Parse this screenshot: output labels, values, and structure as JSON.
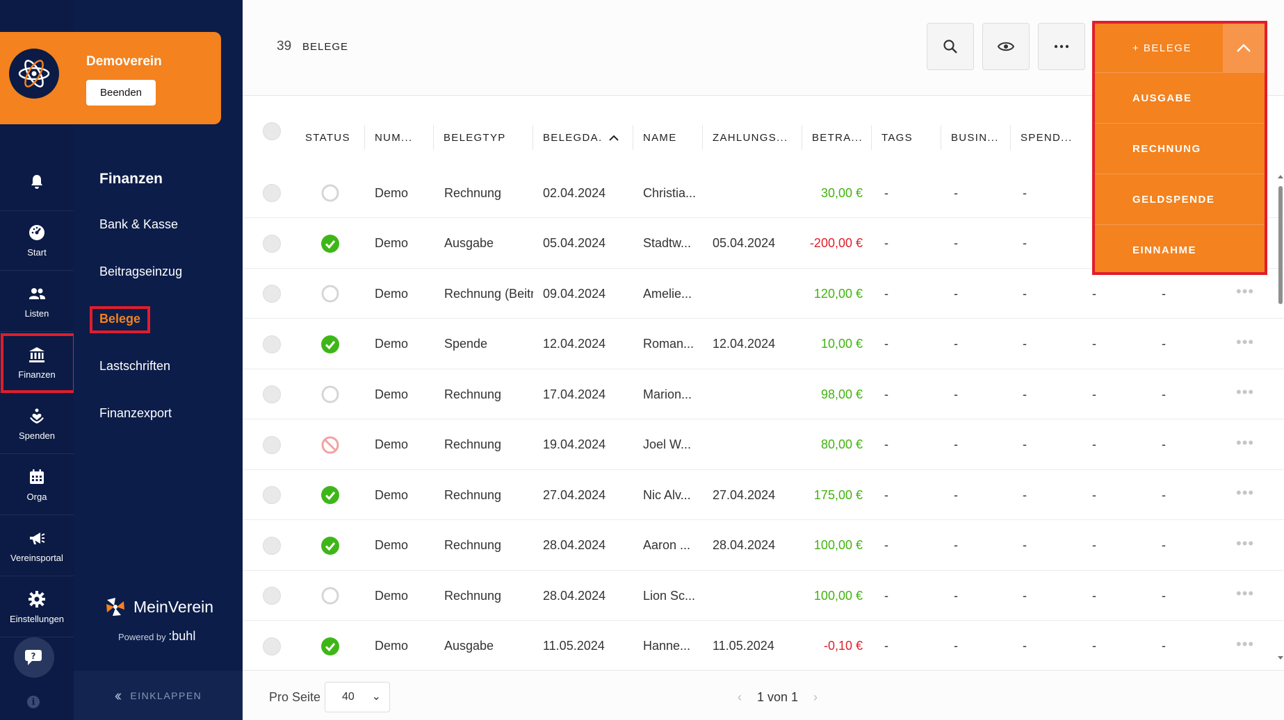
{
  "org": {
    "name": "Demoverein",
    "end_label": "Beenden"
  },
  "rail": [
    {
      "id": "start",
      "label": "Start",
      "icon": "dashboard-icon"
    },
    {
      "id": "listen",
      "label": "Listen",
      "icon": "users-icon"
    },
    {
      "id": "finanzen",
      "label": "Finanzen",
      "icon": "bank-icon"
    },
    {
      "id": "spenden",
      "label": "Spenden",
      "icon": "donation-icon"
    },
    {
      "id": "orga",
      "label": "Orga",
      "icon": "calendar-icon"
    },
    {
      "id": "vereinsportal",
      "label": "Vereinsportal",
      "icon": "megaphone-icon"
    },
    {
      "id": "einstellungen",
      "label": "Einstellungen",
      "icon": "gear-icon"
    }
  ],
  "subnav": {
    "title": "Finanzen",
    "items": [
      "Bank & Kasse",
      "Beitragseinzug",
      "Belege",
      "Lastschriften",
      "Finanzexport"
    ],
    "active": "Belege"
  },
  "brand": {
    "name": "MeinVerein",
    "powered_by": "Powered by",
    "powered_brand": ":buhl"
  },
  "collapse_label": "EINKLAPPEN",
  "header": {
    "count": "39",
    "count_label": "BELEGE"
  },
  "add_menu": {
    "main_label": "+ BELEGE",
    "options": [
      "AUSGABE",
      "RECHNUNG",
      "GELDSPENDE",
      "EINNAHME"
    ]
  },
  "table": {
    "columns": [
      "STATUS",
      "NUM...",
      "BELEGTYP",
      "BELEGDA...",
      "NAME",
      "ZAHLUNGS...",
      "BETRA...",
      "TAGS",
      "BUSIN...",
      "SPEND..."
    ],
    "rows": [
      {
        "status": "open",
        "num": "Demo",
        "typ": "Rechnung",
        "datum": "02.04.2024",
        "name": "Christia...",
        "zahlung": "",
        "betrag": "30,00 €",
        "sign": "pos",
        "tags": "-",
        "busin": "-",
        "spend": "-",
        "c1": "",
        "c2": ""
      },
      {
        "status": "paid",
        "num": "Demo",
        "typ": "Ausgabe",
        "datum": "05.04.2024",
        "name": "Stadtw...",
        "zahlung": "05.04.2024",
        "betrag": "-200,00 €",
        "sign": "neg",
        "tags": "-",
        "busin": "-",
        "spend": "-",
        "c1": "",
        "c2": ""
      },
      {
        "status": "open",
        "num": "Demo",
        "typ": "Rechnung (Beitra",
        "datum": "09.04.2024",
        "name": "Amelie...",
        "zahlung": "",
        "betrag": "120,00 €",
        "sign": "pos",
        "tags": "-",
        "busin": "-",
        "spend": "-",
        "c1": "-",
        "c2": "-"
      },
      {
        "status": "paid",
        "num": "Demo",
        "typ": "Spende",
        "datum": "12.04.2024",
        "name": "Roman...",
        "zahlung": "12.04.2024",
        "betrag": "10,00 €",
        "sign": "pos",
        "tags": "-",
        "busin": "-",
        "spend": "-",
        "c1": "-",
        "c2": "-"
      },
      {
        "status": "open",
        "num": "Demo",
        "typ": "Rechnung",
        "datum": "17.04.2024",
        "name": "Marion...",
        "zahlung": "",
        "betrag": "98,00 €",
        "sign": "pos",
        "tags": "-",
        "busin": "-",
        "spend": "-",
        "c1": "-",
        "c2": "-"
      },
      {
        "status": "cancelled",
        "num": "Demo",
        "typ": "Rechnung",
        "datum": "19.04.2024",
        "name": "Joel W...",
        "zahlung": "",
        "betrag": "80,00 €",
        "sign": "pos",
        "tags": "-",
        "busin": "-",
        "spend": "-",
        "c1": "-",
        "c2": "-"
      },
      {
        "status": "paid",
        "num": "Demo",
        "typ": "Rechnung",
        "datum": "27.04.2024",
        "name": "Nic Alv...",
        "zahlung": "27.04.2024",
        "betrag": "175,00 €",
        "sign": "pos",
        "tags": "-",
        "busin": "-",
        "spend": "-",
        "c1": "-",
        "c2": "-"
      },
      {
        "status": "paid",
        "num": "Demo",
        "typ": "Rechnung",
        "datum": "28.04.2024",
        "name": "Aaron ...",
        "zahlung": "28.04.2024",
        "betrag": "100,00 €",
        "sign": "pos",
        "tags": "-",
        "busin": "-",
        "spend": "-",
        "c1": "-",
        "c2": "-"
      },
      {
        "status": "open",
        "num": "Demo",
        "typ": "Rechnung",
        "datum": "28.04.2024",
        "name": "Lion Sc...",
        "zahlung": "",
        "betrag": "100,00 €",
        "sign": "pos",
        "tags": "-",
        "busin": "-",
        "spend": "-",
        "c1": "-",
        "c2": "-"
      },
      {
        "status": "paid",
        "num": "Demo",
        "typ": "Ausgabe",
        "datum": "11.05.2024",
        "name": "Hanne...",
        "zahlung": "11.05.2024",
        "betrag": "-0,10 €",
        "sign": "neg",
        "tags": "-",
        "busin": "-",
        "spend": "-",
        "c1": "-",
        "c2": "-"
      }
    ]
  },
  "footer": {
    "per_page_label": "Pro Seite",
    "per_page_value": "40",
    "page_text": "1 von 1"
  },
  "colors": {
    "accent": "#f3821f",
    "nav_bg": "#0b1b45",
    "highlight": "#e11d2b",
    "positive": "#42b310",
    "negative": "#e0212b"
  }
}
